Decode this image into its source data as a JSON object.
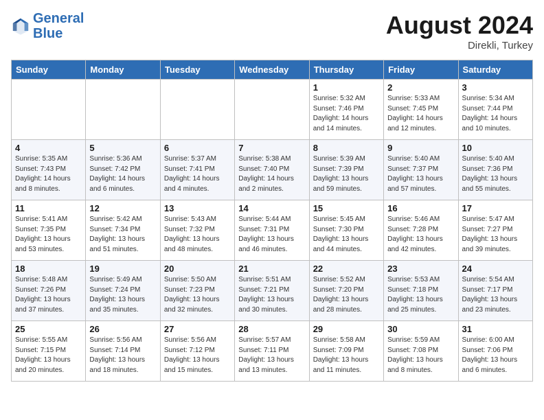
{
  "header": {
    "logo_line1": "General",
    "logo_line2": "Blue",
    "month": "August 2024",
    "location": "Direkli, Turkey"
  },
  "weekdays": [
    "Sunday",
    "Monday",
    "Tuesday",
    "Wednesday",
    "Thursday",
    "Friday",
    "Saturday"
  ],
  "weeks": [
    [
      {
        "day": "",
        "info": ""
      },
      {
        "day": "",
        "info": ""
      },
      {
        "day": "",
        "info": ""
      },
      {
        "day": "",
        "info": ""
      },
      {
        "day": "1",
        "info": "Sunrise: 5:32 AM\nSunset: 7:46 PM\nDaylight: 14 hours\nand 14 minutes."
      },
      {
        "day": "2",
        "info": "Sunrise: 5:33 AM\nSunset: 7:45 PM\nDaylight: 14 hours\nand 12 minutes."
      },
      {
        "day": "3",
        "info": "Sunrise: 5:34 AM\nSunset: 7:44 PM\nDaylight: 14 hours\nand 10 minutes."
      }
    ],
    [
      {
        "day": "4",
        "info": "Sunrise: 5:35 AM\nSunset: 7:43 PM\nDaylight: 14 hours\nand 8 minutes."
      },
      {
        "day": "5",
        "info": "Sunrise: 5:36 AM\nSunset: 7:42 PM\nDaylight: 14 hours\nand 6 minutes."
      },
      {
        "day": "6",
        "info": "Sunrise: 5:37 AM\nSunset: 7:41 PM\nDaylight: 14 hours\nand 4 minutes."
      },
      {
        "day": "7",
        "info": "Sunrise: 5:38 AM\nSunset: 7:40 PM\nDaylight: 14 hours\nand 2 minutes."
      },
      {
        "day": "8",
        "info": "Sunrise: 5:39 AM\nSunset: 7:39 PM\nDaylight: 13 hours\nand 59 minutes."
      },
      {
        "day": "9",
        "info": "Sunrise: 5:40 AM\nSunset: 7:37 PM\nDaylight: 13 hours\nand 57 minutes."
      },
      {
        "day": "10",
        "info": "Sunrise: 5:40 AM\nSunset: 7:36 PM\nDaylight: 13 hours\nand 55 minutes."
      }
    ],
    [
      {
        "day": "11",
        "info": "Sunrise: 5:41 AM\nSunset: 7:35 PM\nDaylight: 13 hours\nand 53 minutes."
      },
      {
        "day": "12",
        "info": "Sunrise: 5:42 AM\nSunset: 7:34 PM\nDaylight: 13 hours\nand 51 minutes."
      },
      {
        "day": "13",
        "info": "Sunrise: 5:43 AM\nSunset: 7:32 PM\nDaylight: 13 hours\nand 48 minutes."
      },
      {
        "day": "14",
        "info": "Sunrise: 5:44 AM\nSunset: 7:31 PM\nDaylight: 13 hours\nand 46 minutes."
      },
      {
        "day": "15",
        "info": "Sunrise: 5:45 AM\nSunset: 7:30 PM\nDaylight: 13 hours\nand 44 minutes."
      },
      {
        "day": "16",
        "info": "Sunrise: 5:46 AM\nSunset: 7:28 PM\nDaylight: 13 hours\nand 42 minutes."
      },
      {
        "day": "17",
        "info": "Sunrise: 5:47 AM\nSunset: 7:27 PM\nDaylight: 13 hours\nand 39 minutes."
      }
    ],
    [
      {
        "day": "18",
        "info": "Sunrise: 5:48 AM\nSunset: 7:26 PM\nDaylight: 13 hours\nand 37 minutes."
      },
      {
        "day": "19",
        "info": "Sunrise: 5:49 AM\nSunset: 7:24 PM\nDaylight: 13 hours\nand 35 minutes."
      },
      {
        "day": "20",
        "info": "Sunrise: 5:50 AM\nSunset: 7:23 PM\nDaylight: 13 hours\nand 32 minutes."
      },
      {
        "day": "21",
        "info": "Sunrise: 5:51 AM\nSunset: 7:21 PM\nDaylight: 13 hours\nand 30 minutes."
      },
      {
        "day": "22",
        "info": "Sunrise: 5:52 AM\nSunset: 7:20 PM\nDaylight: 13 hours\nand 28 minutes."
      },
      {
        "day": "23",
        "info": "Sunrise: 5:53 AM\nSunset: 7:18 PM\nDaylight: 13 hours\nand 25 minutes."
      },
      {
        "day": "24",
        "info": "Sunrise: 5:54 AM\nSunset: 7:17 PM\nDaylight: 13 hours\nand 23 minutes."
      }
    ],
    [
      {
        "day": "25",
        "info": "Sunrise: 5:55 AM\nSunset: 7:15 PM\nDaylight: 13 hours\nand 20 minutes."
      },
      {
        "day": "26",
        "info": "Sunrise: 5:56 AM\nSunset: 7:14 PM\nDaylight: 13 hours\nand 18 minutes."
      },
      {
        "day": "27",
        "info": "Sunrise: 5:56 AM\nSunset: 7:12 PM\nDaylight: 13 hours\nand 15 minutes."
      },
      {
        "day": "28",
        "info": "Sunrise: 5:57 AM\nSunset: 7:11 PM\nDaylight: 13 hours\nand 13 minutes."
      },
      {
        "day": "29",
        "info": "Sunrise: 5:58 AM\nSunset: 7:09 PM\nDaylight: 13 hours\nand 11 minutes."
      },
      {
        "day": "30",
        "info": "Sunrise: 5:59 AM\nSunset: 7:08 PM\nDaylight: 13 hours\nand 8 minutes."
      },
      {
        "day": "31",
        "info": "Sunrise: 6:00 AM\nSunset: 7:06 PM\nDaylight: 13 hours\nand 6 minutes."
      }
    ]
  ]
}
